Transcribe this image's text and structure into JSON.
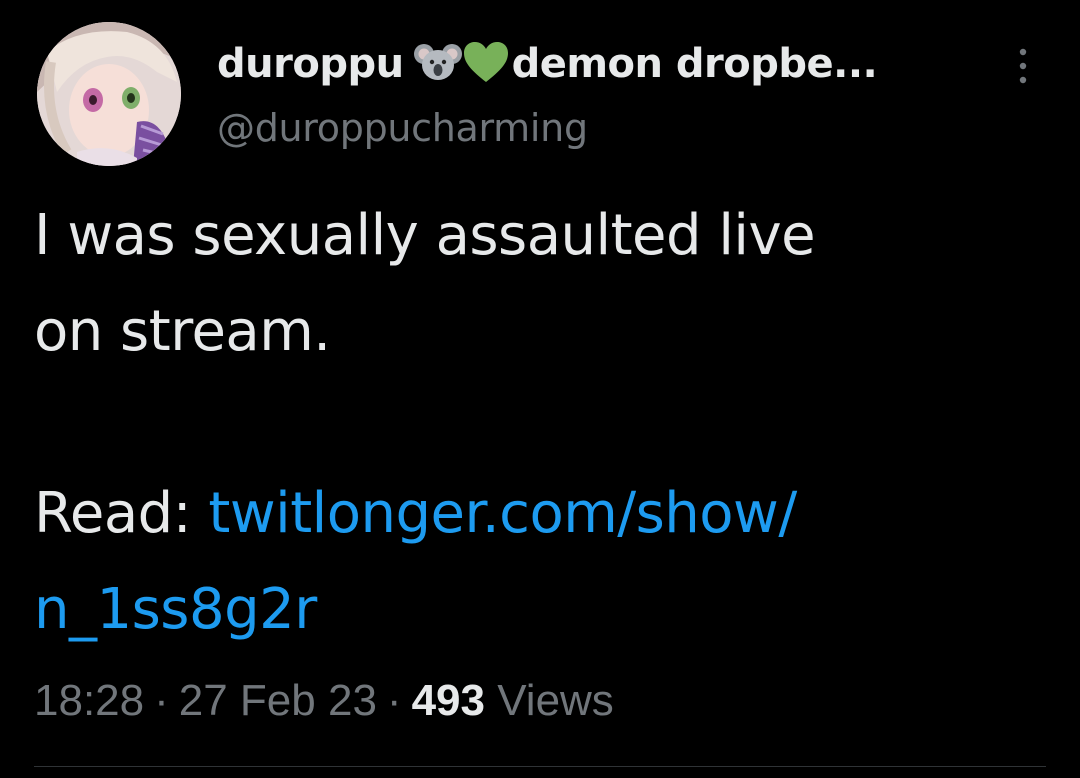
{
  "tweet": {
    "display_name": "duroppu",
    "display_name_suffix": "demon dropbe...",
    "handle": "@duroppucharming",
    "emojis": [
      "koala-icon",
      "green-heart-icon"
    ],
    "text_line_1": "I was sexually assaulted live",
    "text_line_2": "on stream.",
    "read_label": "Read: ",
    "link_line_1": "twitlonger.com/show/",
    "link_line_2": "n_1ss8g2r",
    "time": "18:28",
    "date": "27 Feb 23",
    "views_count": "493",
    "views_label": "Views",
    "separator": "·"
  },
  "colors": {
    "background": "#000000",
    "primary_text": "#e7e9ea",
    "secondary_text": "#71767b",
    "link": "#1d9bf0",
    "divider": "#2f3336"
  }
}
